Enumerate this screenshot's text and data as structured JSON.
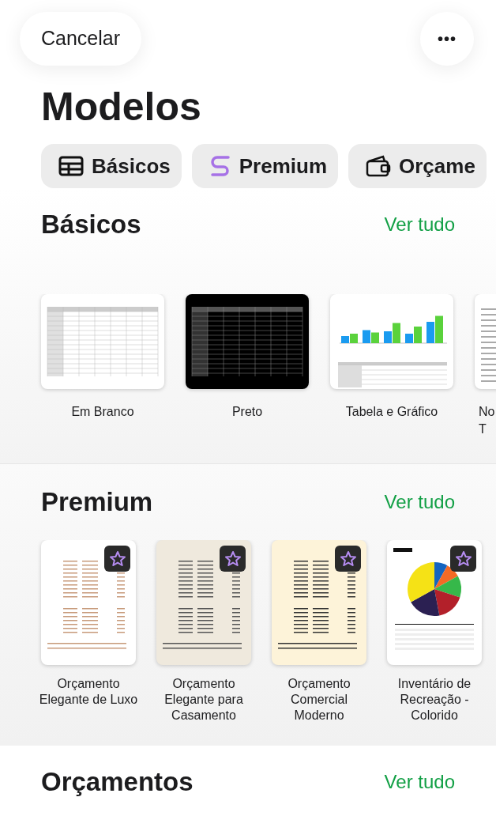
{
  "top_bar": {
    "cancel": "Cancelar",
    "more": "•••"
  },
  "title": "Modelos",
  "categories": [
    {
      "label": "Básicos",
      "selected": false
    },
    {
      "label": "Premium",
      "selected": false
    },
    {
      "label": "Orçame",
      "selected": false
    }
  ],
  "sections": [
    {
      "heading": "Básicos",
      "see_all": "Ver tudo",
      "templates": [
        {
          "label": "Em Branco",
          "kind": "blank-grid",
          "premium": false
        },
        {
          "label": "Preto",
          "kind": "black-grid",
          "premium": false
        },
        {
          "label": "Tabela e Gráfico",
          "kind": "chart",
          "premium": false
        },
        {
          "label": "No\nT",
          "kind": "text-doc",
          "premium": false
        }
      ]
    },
    {
      "heading": "Premium",
      "see_all": "Ver tudo",
      "templates": [
        {
          "label": "Orçamento Elegante de Luxo",
          "kind": "budget-white",
          "premium": true
        },
        {
          "label": "Orçamento Elegante para Casamento",
          "kind": "budget-beige",
          "premium": true
        },
        {
          "label": "Orçamento Comercial Moderno",
          "kind": "budget-cream",
          "premium": true
        },
        {
          "label": "Inventário de Recreação - Colorido",
          "kind": "inventory",
          "premium": true
        }
      ]
    },
    {
      "heading": "Orçamentos",
      "see_all": "Ver tudo"
    }
  ]
}
